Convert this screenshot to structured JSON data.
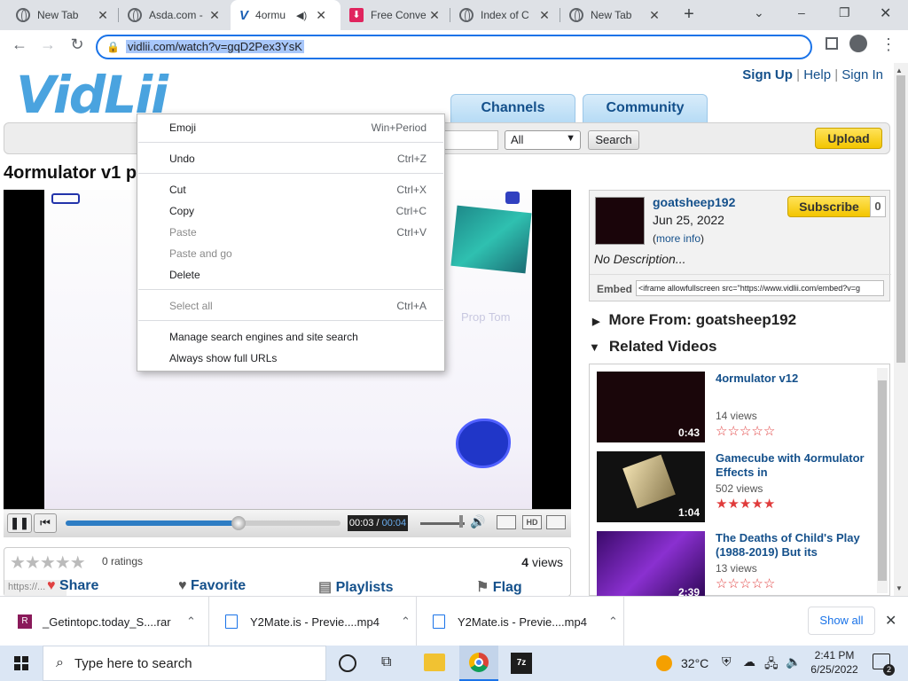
{
  "browser": {
    "tabs": [
      {
        "title": "New Tab",
        "icon": "globe-icon"
      },
      {
        "title": "Asda.com -",
        "icon": "globe-icon"
      },
      {
        "title": "4ormu",
        "icon": "vidlii-icon",
        "active": true,
        "audio": "speaker-icon"
      },
      {
        "title": "Free Conve",
        "icon": "download-icon"
      },
      {
        "title": "Index of C",
        "icon": "globe-icon"
      },
      {
        "title": "New Tab",
        "icon": "globe-icon"
      }
    ],
    "url": "vidlii.com/watch?v=gqD2Pex3YsK",
    "new_tab_symbol": "+",
    "window_controls": {
      "minimize": "–",
      "restore": "❐",
      "close": "✕"
    }
  },
  "site": {
    "logo": "VidLii",
    "top_links": {
      "signup": "Sign Up",
      "sep1": "|",
      "help": "Help",
      "sep2": "|",
      "signin": "Sign In"
    },
    "nav_tabs": [
      "Channels",
      "Community"
    ],
    "search": {
      "filter": "All",
      "button": "Search"
    },
    "upload": "Upload",
    "video_title": "4ormulator v1 p"
  },
  "player": {
    "time_current": "00:03",
    "time_sep": "/",
    "time_total": "00:04",
    "hd_label": "HD",
    "progress_fraction": 0.63,
    "overlay_text": "Prop Tom"
  },
  "info": {
    "ratings": "0 ratings",
    "views_count": "4",
    "views_label": "views",
    "actions": {
      "share": "Share",
      "favorite": "Favorite",
      "playlists": "Playlists",
      "flag": "Flag"
    },
    "status_url": "https://..."
  },
  "channel": {
    "name": "goatsheep192",
    "date": "Jun 25, 2022",
    "more_info_open": "(",
    "more_info": "more info",
    "more_info_close": ")",
    "subscribe": "Subscribe",
    "subscribers": "0",
    "description": "No Description...",
    "embed_label": "Embed",
    "embed_code": "<iframe allowfullscreen src=\"https://www.vidlii.com/embed?v=g"
  },
  "sections": {
    "more_from": "More From: goatsheep192",
    "related": "Related Videos"
  },
  "related_videos": [
    {
      "title": "4ormulator v12",
      "views": "14 views",
      "duration": "0:43",
      "rating": 0
    },
    {
      "title": "Gamecube with 4ormulator Effects in",
      "views": "502 views",
      "duration": "1:04",
      "rating": 5
    },
    {
      "title": "The Deaths of Child's Play (1988-2019) But its",
      "views": "13 views",
      "duration": "2:39",
      "rating": 0
    }
  ],
  "context_menu": {
    "items": [
      {
        "label": "Emoji",
        "shortcut": "Win+Period",
        "disabled": false
      },
      {
        "label": "Undo",
        "shortcut": "Ctrl+Z",
        "disabled": false
      },
      {
        "label": "Cut",
        "shortcut": "Ctrl+X",
        "disabled": false
      },
      {
        "label": "Copy",
        "shortcut": "Ctrl+C",
        "disabled": false
      },
      {
        "label": "Paste",
        "shortcut": "Ctrl+V",
        "disabled": true
      },
      {
        "label": "Paste and go",
        "shortcut": "",
        "disabled": true
      },
      {
        "label": "Delete",
        "shortcut": "",
        "disabled": false
      },
      {
        "label": "Select all",
        "shortcut": "Ctrl+A",
        "disabled": true
      },
      {
        "label": "Manage search engines and site search",
        "shortcut": "",
        "disabled": false
      },
      {
        "label": "Always show full URLs",
        "shortcut": "",
        "disabled": false
      }
    ]
  },
  "downloads": {
    "items": [
      "_Getintopc.today_S....rar",
      "Y2Mate.is - Previe....mp4",
      "Y2Mate.is - Previe....mp4"
    ],
    "show_all": "Show all"
  },
  "taskbar": {
    "search_placeholder": "Type here to search",
    "weather": "32°C",
    "time": "2:41 PM",
    "date": "6/25/2022",
    "notifications": "2"
  },
  "colors": {
    "accent": "#1a73e8",
    "link": "#14508b",
    "upload": "#f3c500",
    "star_filled": "#e03b3b"
  }
}
